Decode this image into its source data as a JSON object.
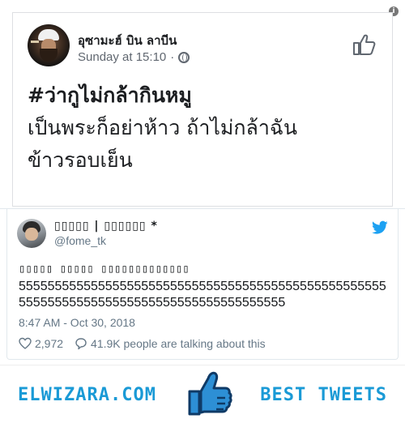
{
  "info_glyph": "i",
  "facebook_post": {
    "author": "อุซามะฮ์ บิน ลาบีน",
    "timestamp": "Sunday at 15:10",
    "separator": "·",
    "hashtag": "#ว่ากูไม่กล้ากินหมู",
    "line2": "เป็นพระก็อย่าห้าว ถ้าไม่กล้าฉัน",
    "line3": "ข้าวรอบเย็น",
    "icons": [
      "globe-icon",
      "thumb-outline-icon"
    ]
  },
  "tweet": {
    "display_name": "▯▯▯▯▯ | ▯▯▯▯▯▯ *",
    "handle": "@fome_tk",
    "glyph_line": "▯▯▯▯▯ ▯▯▯▯▯ ▯▯▯▯▯▯▯▯▯▯▯▯▯",
    "text": "5555555555555555555555555555555555555555555555555555555555555555555555555555555555555555",
    "time": "8:47 AM - Oct 30, 2018",
    "likes": "2,972",
    "talking": "41.9K people are talking about this",
    "icons": [
      "twitter-bird-icon",
      "heart-icon",
      "bubble-icon"
    ]
  },
  "footer": {
    "brand": "ELWIZARA.COM",
    "tagline": "BEST TWEETS",
    "icon": "thumbs-up-icon"
  },
  "colors": {
    "twitter_blue": "#1da1f2",
    "brand_blue": "#1a9ad6",
    "muted": "#657786"
  }
}
